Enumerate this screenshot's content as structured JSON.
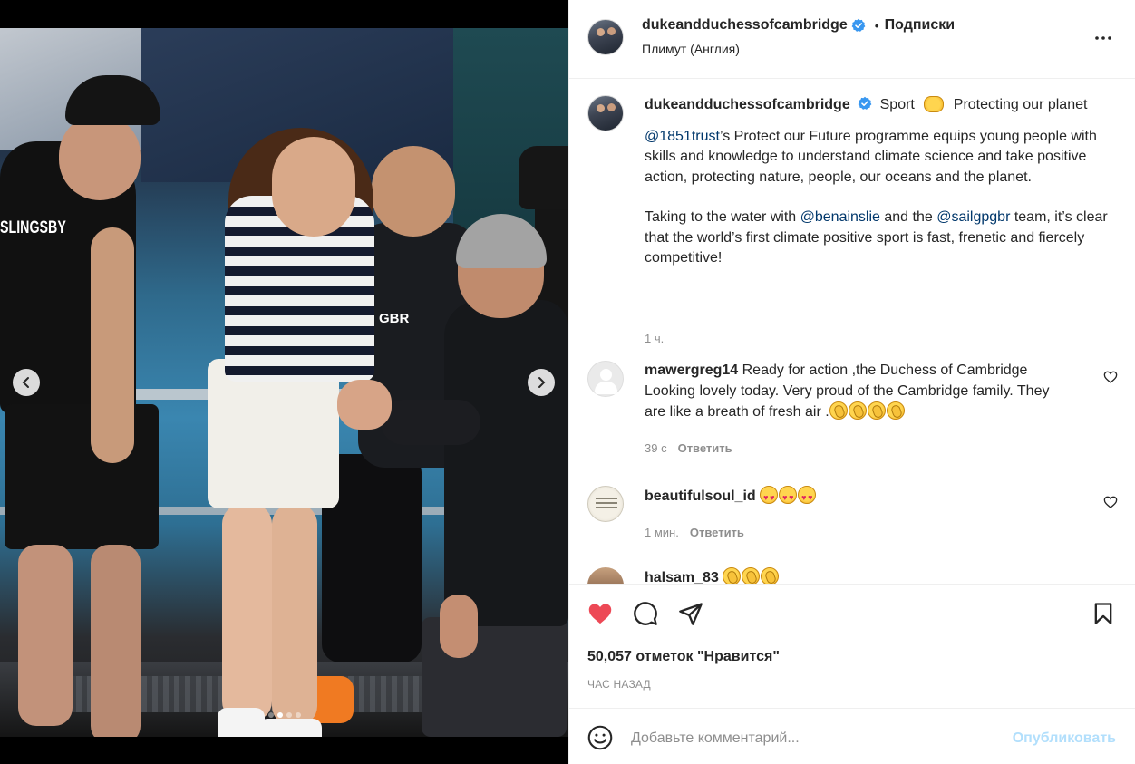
{
  "post": {
    "username": "dukeandduchessofcambridge",
    "follow_separator": "•",
    "follow_label": "Подписки",
    "location": "Плимут (Англия)",
    "photo_jersey_text": "SLINGSBY",
    "photo_vest_text": "GBR",
    "carousel": {
      "total": 4,
      "active": 2
    }
  },
  "caption": {
    "username": "dukeandduchessofcambridge",
    "line1_text": "Sport",
    "line1_text2": "Protecting our planet",
    "mention1": "@1851trust",
    "par1_rest": "’s Protect our Future programme equips young people with skills and knowledge to understand climate science and take positive action, protecting nature, people, our oceans and the planet.",
    "par2_a": "Taking to the water with ",
    "mention2": "@benainslie",
    "par2_b": " and the ",
    "mention3": "@sailgpgbr",
    "par2_c": " team, it’s clear that the world’s first climate positive sport is fast, frenetic and fiercely competitive!",
    "time": "1 ч."
  },
  "comments": [
    {
      "username": "mawergreg14",
      "text": "Ready for action ,the Duchess of Cambridge Looking lovely today. Very proud of the Cambridge family. They are like a breath of fresh air .",
      "time": "39 с",
      "reply": "Ответить"
    },
    {
      "username": "beautifulsoul_id",
      "text": "",
      "time": "1 мин.",
      "reply": "Ответить"
    },
    {
      "username": "halsam_83",
      "text": ""
    }
  ],
  "actions": {
    "likes": "50,057 отметок \"Нравится\"",
    "posted": "ЧАС НАЗАД",
    "like_color": "#ed4956"
  },
  "add_comment": {
    "placeholder": "Добавьте комментарий...",
    "publish": "Опубликовать"
  }
}
